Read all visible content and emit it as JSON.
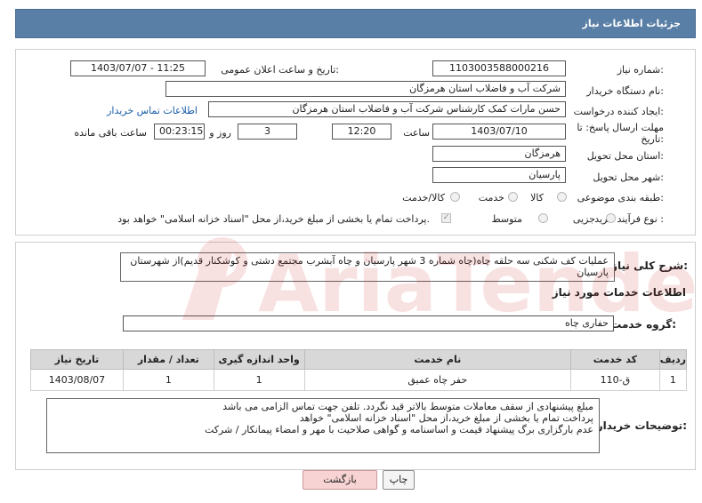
{
  "header": {
    "title": "جزئیات اطلاعات نیاز"
  },
  "form": {
    "need_number_label": "شماره نیاز:",
    "need_number": "1103003588000216",
    "announce_label": "تاریخ و ساعت اعلان عمومی:",
    "announce_value": "1403/07/07 - 11:25",
    "buyer_org_label": "نام دستگاه خریدار:",
    "buyer_org": "شرکت آب و فاضلاب استان هرمزگان",
    "creator_label": "ایجاد کننده درخواست:",
    "creator": "حسن مارات کمک کارشناس شرکت آب و فاضلاب استان هرمزگان",
    "contact_link": "اطلاعات تماس خریدار",
    "deadline_label_1": "مهلت ارسال پاسخ: تا",
    "deadline_label_2": "تاریخ:",
    "deadline_date": "1403/07/10",
    "time_label": "ساعت",
    "deadline_time": "12:20",
    "days_value": "3",
    "days_label": "روز و",
    "remaining_time": "00:23:15",
    "remaining_label": "ساعت باقی مانده",
    "province_label": "استان محل تحویل:",
    "province": "هرمزگان",
    "city_label": "شهر محل تحویل:",
    "city": "پارسیان",
    "category_label": "طبقه بندی موضوعی:",
    "category_options": [
      "کالا",
      "خدمت",
      "کالا/خدمت"
    ],
    "process_label": "نوع فرآیند خرید :",
    "process_options": [
      "جزیی",
      "متوسط"
    ],
    "payment_note": "پرداخت تمام یا بخشی از مبلغ خرید،از محل \"اسناد خزانه اسلامی\" خواهد بود."
  },
  "summary": {
    "label": "شرح کلی نیاز:",
    "text": "عملیات کف شکنی سه حلقه چاه(چاه شماره 3 شهر پارسیان و چاه آبشرب مجتمع دشتی و کوشکنار قدیم)از شهرستان پارسیان"
  },
  "services": {
    "section_title": "اطلاعات خدمات مورد نیاز",
    "group_label": "گروه خدمت:",
    "group_value": "حفاری چاه",
    "columns": [
      "ردیف",
      "کد خدمت",
      "نام خدمت",
      "واحد اندازه گیری",
      "تعداد / مقدار",
      "تاریخ نیاز"
    ],
    "rows": [
      [
        "1",
        "ق-110",
        "حفر چاه عمیق",
        "1",
        "1",
        "1403/08/07"
      ]
    ]
  },
  "buyer_notes": {
    "label": "توضیحات خریدار:",
    "lines": [
      "مبلغ پیشنهادی از سقف معاملات متوسط بالاتر قید نگردد. تلفن جهت تماس الزامی می باشد",
      "پرداخت تمام یا بخشی از مبلغ خرید،از محل \"اسناد خزانه اسلامی\" خواهد",
      "عدم بارگزاری برگ پیشنهاد قیمت و اساسنامه و گواهی صلاحیت با مهر و امضاء پیمانکار / شرکت"
    ]
  },
  "buttons": {
    "print": "چاپ",
    "back": "بازگشت"
  },
  "watermark": {
    "text": "AriaTender.net"
  },
  "colors": {
    "header_bg": "#5a7fa6",
    "link": "#1a5ea8",
    "back_button": "#f7d3d3",
    "watermark": "#cc2222"
  }
}
